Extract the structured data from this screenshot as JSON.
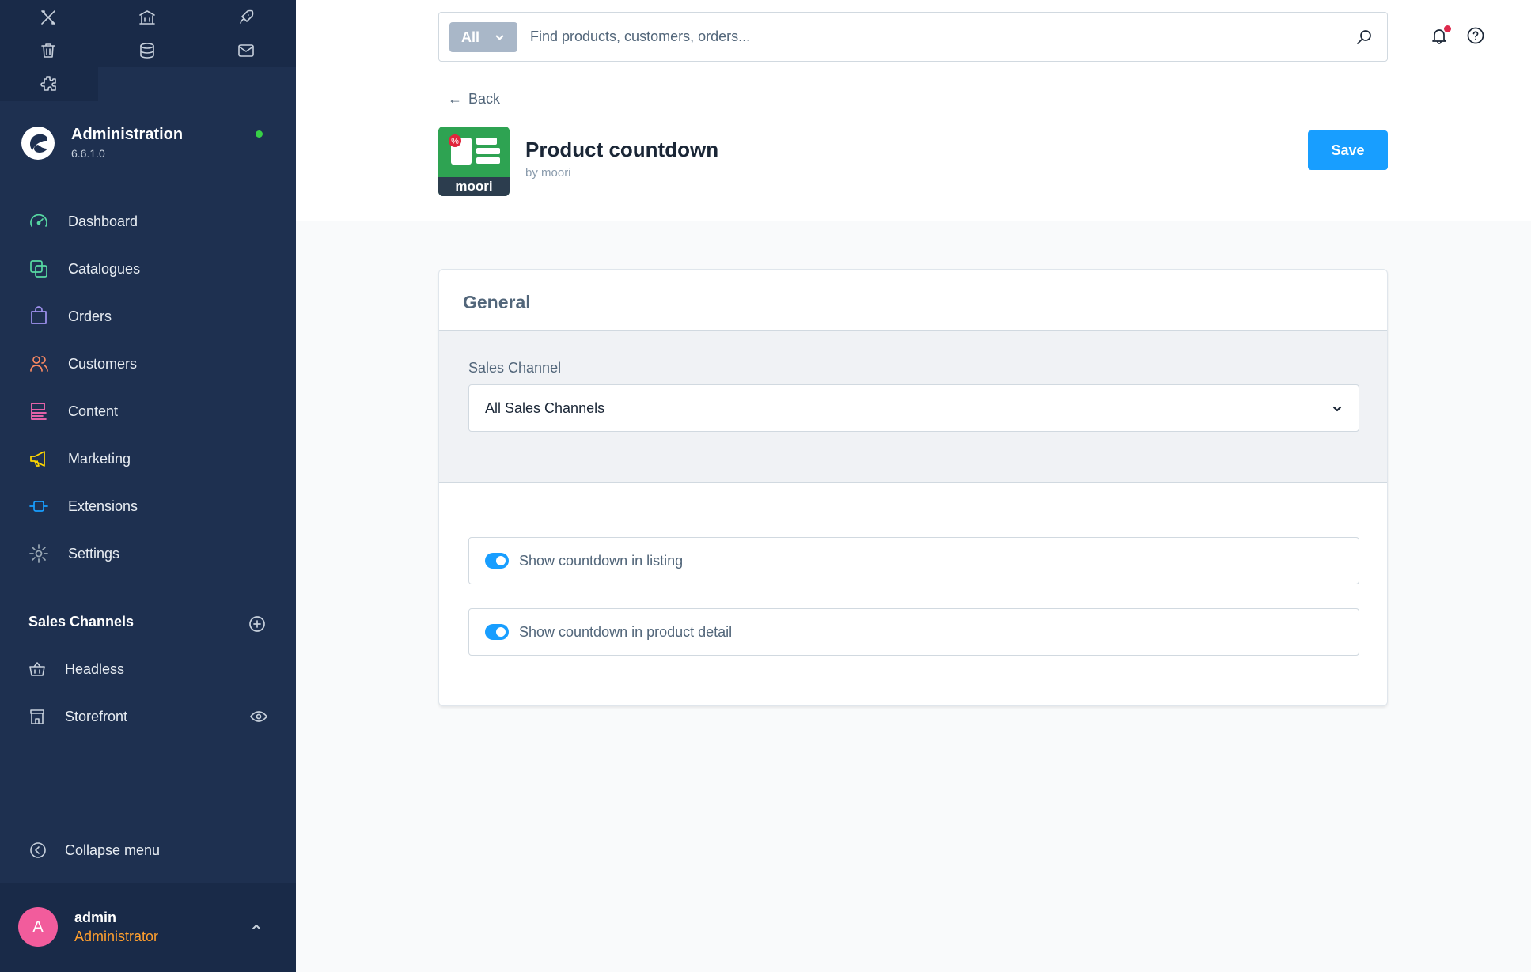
{
  "sidebar": {
    "brand": {
      "title": "Administration",
      "version": "6.6.1.0"
    },
    "nav": [
      {
        "label": "Dashboard",
        "icon": "gauge-icon",
        "color": "#57d9a3"
      },
      {
        "label": "Catalogues",
        "icon": "catalogue-icon",
        "color": "#57d9a3"
      },
      {
        "label": "Orders",
        "icon": "shopping-bag-icon",
        "color": "#a092f0"
      },
      {
        "label": "Customers",
        "icon": "users-icon",
        "color": "#f88962"
      },
      {
        "label": "Content",
        "icon": "content-icon",
        "color": "#ff68b4"
      },
      {
        "label": "Marketing",
        "icon": "megaphone-icon",
        "color": "#ffd700"
      },
      {
        "label": "Extensions",
        "icon": "plug-icon",
        "color": "#189eff"
      },
      {
        "label": "Settings",
        "icon": "gear-icon",
        "color": "#9aa8b5"
      }
    ],
    "sales_channels": {
      "title": "Sales Channels",
      "items": [
        {
          "label": "Headless",
          "icon": "basket-icon"
        },
        {
          "label": "Storefront",
          "icon": "storefront-icon"
        }
      ]
    },
    "collapse_label": "Collapse menu",
    "user": {
      "initial": "A",
      "name": "admin",
      "role": "Administrator"
    }
  },
  "topbar": {
    "search_type": "All",
    "search_placeholder": "Find products, customers, orders..."
  },
  "page": {
    "back_label": "Back",
    "title": "Product countdown",
    "author": "by moori",
    "extension_icon_label": "moori",
    "save_label": "Save"
  },
  "card": {
    "title": "General",
    "sales_channel_label": "Sales Channel",
    "sales_channel_value": "All Sales Channels",
    "toggles": [
      {
        "label": "Show countdown in listing",
        "enabled": true
      },
      {
        "label": "Show countdown in product detail",
        "enabled": true
      }
    ]
  },
  "colors": {
    "sidebar_bg": "#1e3050",
    "accent": "#189eff",
    "status_online": "#37d046",
    "user_role": "#ff9f2e",
    "avatar": "#f25c9c"
  }
}
